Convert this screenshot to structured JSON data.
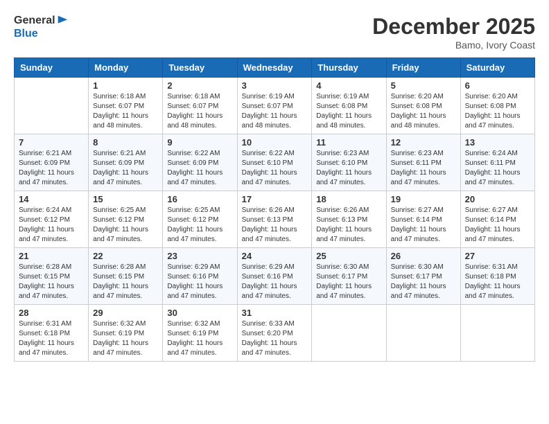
{
  "header": {
    "logo_general": "General",
    "logo_blue": "Blue",
    "month_title": "December 2025",
    "location": "Bamo, Ivory Coast"
  },
  "days_of_week": [
    "Sunday",
    "Monday",
    "Tuesday",
    "Wednesday",
    "Thursday",
    "Friday",
    "Saturday"
  ],
  "weeks": [
    [
      {
        "day": "",
        "sunrise": "",
        "sunset": "",
        "daylight": ""
      },
      {
        "day": "1",
        "sunrise": "Sunrise: 6:18 AM",
        "sunset": "Sunset: 6:07 PM",
        "daylight": "Daylight: 11 hours and 48 minutes."
      },
      {
        "day": "2",
        "sunrise": "Sunrise: 6:18 AM",
        "sunset": "Sunset: 6:07 PM",
        "daylight": "Daylight: 11 hours and 48 minutes."
      },
      {
        "day": "3",
        "sunrise": "Sunrise: 6:19 AM",
        "sunset": "Sunset: 6:07 PM",
        "daylight": "Daylight: 11 hours and 48 minutes."
      },
      {
        "day": "4",
        "sunrise": "Sunrise: 6:19 AM",
        "sunset": "Sunset: 6:08 PM",
        "daylight": "Daylight: 11 hours and 48 minutes."
      },
      {
        "day": "5",
        "sunrise": "Sunrise: 6:20 AM",
        "sunset": "Sunset: 6:08 PM",
        "daylight": "Daylight: 11 hours and 48 minutes."
      },
      {
        "day": "6",
        "sunrise": "Sunrise: 6:20 AM",
        "sunset": "Sunset: 6:08 PM",
        "daylight": "Daylight: 11 hours and 47 minutes."
      }
    ],
    [
      {
        "day": "7",
        "sunrise": "Sunrise: 6:21 AM",
        "sunset": "Sunset: 6:09 PM",
        "daylight": "Daylight: 11 hours and 47 minutes."
      },
      {
        "day": "8",
        "sunrise": "Sunrise: 6:21 AM",
        "sunset": "Sunset: 6:09 PM",
        "daylight": "Daylight: 11 hours and 47 minutes."
      },
      {
        "day": "9",
        "sunrise": "Sunrise: 6:22 AM",
        "sunset": "Sunset: 6:09 PM",
        "daylight": "Daylight: 11 hours and 47 minutes."
      },
      {
        "day": "10",
        "sunrise": "Sunrise: 6:22 AM",
        "sunset": "Sunset: 6:10 PM",
        "daylight": "Daylight: 11 hours and 47 minutes."
      },
      {
        "day": "11",
        "sunrise": "Sunrise: 6:23 AM",
        "sunset": "Sunset: 6:10 PM",
        "daylight": "Daylight: 11 hours and 47 minutes."
      },
      {
        "day": "12",
        "sunrise": "Sunrise: 6:23 AM",
        "sunset": "Sunset: 6:11 PM",
        "daylight": "Daylight: 11 hours and 47 minutes."
      },
      {
        "day": "13",
        "sunrise": "Sunrise: 6:24 AM",
        "sunset": "Sunset: 6:11 PM",
        "daylight": "Daylight: 11 hours and 47 minutes."
      }
    ],
    [
      {
        "day": "14",
        "sunrise": "Sunrise: 6:24 AM",
        "sunset": "Sunset: 6:12 PM",
        "daylight": "Daylight: 11 hours and 47 minutes."
      },
      {
        "day": "15",
        "sunrise": "Sunrise: 6:25 AM",
        "sunset": "Sunset: 6:12 PM",
        "daylight": "Daylight: 11 hours and 47 minutes."
      },
      {
        "day": "16",
        "sunrise": "Sunrise: 6:25 AM",
        "sunset": "Sunset: 6:12 PM",
        "daylight": "Daylight: 11 hours and 47 minutes."
      },
      {
        "day": "17",
        "sunrise": "Sunrise: 6:26 AM",
        "sunset": "Sunset: 6:13 PM",
        "daylight": "Daylight: 11 hours and 47 minutes."
      },
      {
        "day": "18",
        "sunrise": "Sunrise: 6:26 AM",
        "sunset": "Sunset: 6:13 PM",
        "daylight": "Daylight: 11 hours and 47 minutes."
      },
      {
        "day": "19",
        "sunrise": "Sunrise: 6:27 AM",
        "sunset": "Sunset: 6:14 PM",
        "daylight": "Daylight: 11 hours and 47 minutes."
      },
      {
        "day": "20",
        "sunrise": "Sunrise: 6:27 AM",
        "sunset": "Sunset: 6:14 PM",
        "daylight": "Daylight: 11 hours and 47 minutes."
      }
    ],
    [
      {
        "day": "21",
        "sunrise": "Sunrise: 6:28 AM",
        "sunset": "Sunset: 6:15 PM",
        "daylight": "Daylight: 11 hours and 47 minutes."
      },
      {
        "day": "22",
        "sunrise": "Sunrise: 6:28 AM",
        "sunset": "Sunset: 6:15 PM",
        "daylight": "Daylight: 11 hours and 47 minutes."
      },
      {
        "day": "23",
        "sunrise": "Sunrise: 6:29 AM",
        "sunset": "Sunset: 6:16 PM",
        "daylight": "Daylight: 11 hours and 47 minutes."
      },
      {
        "day": "24",
        "sunrise": "Sunrise: 6:29 AM",
        "sunset": "Sunset: 6:16 PM",
        "daylight": "Daylight: 11 hours and 47 minutes."
      },
      {
        "day": "25",
        "sunrise": "Sunrise: 6:30 AM",
        "sunset": "Sunset: 6:17 PM",
        "daylight": "Daylight: 11 hours and 47 minutes."
      },
      {
        "day": "26",
        "sunrise": "Sunrise: 6:30 AM",
        "sunset": "Sunset: 6:17 PM",
        "daylight": "Daylight: 11 hours and 47 minutes."
      },
      {
        "day": "27",
        "sunrise": "Sunrise: 6:31 AM",
        "sunset": "Sunset: 6:18 PM",
        "daylight": "Daylight: 11 hours and 47 minutes."
      }
    ],
    [
      {
        "day": "28",
        "sunrise": "Sunrise: 6:31 AM",
        "sunset": "Sunset: 6:18 PM",
        "daylight": "Daylight: 11 hours and 47 minutes."
      },
      {
        "day": "29",
        "sunrise": "Sunrise: 6:32 AM",
        "sunset": "Sunset: 6:19 PM",
        "daylight": "Daylight: 11 hours and 47 minutes."
      },
      {
        "day": "30",
        "sunrise": "Sunrise: 6:32 AM",
        "sunset": "Sunset: 6:19 PM",
        "daylight": "Daylight: 11 hours and 47 minutes."
      },
      {
        "day": "31",
        "sunrise": "Sunrise: 6:33 AM",
        "sunset": "Sunset: 6:20 PM",
        "daylight": "Daylight: 11 hours and 47 minutes."
      },
      {
        "day": "",
        "sunrise": "",
        "sunset": "",
        "daylight": ""
      },
      {
        "day": "",
        "sunrise": "",
        "sunset": "",
        "daylight": ""
      },
      {
        "day": "",
        "sunrise": "",
        "sunset": "",
        "daylight": ""
      }
    ]
  ]
}
